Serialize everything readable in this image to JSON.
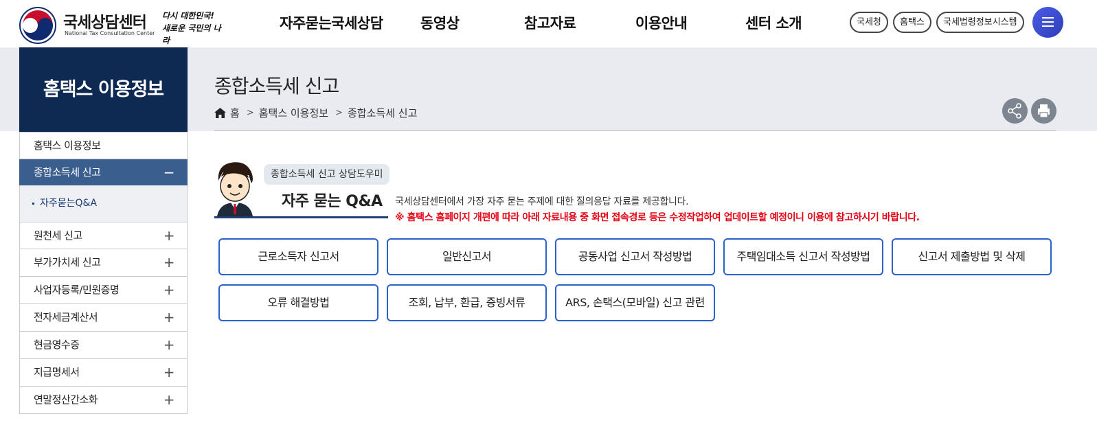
{
  "header": {
    "logo_title": "국세상담센터",
    "logo_subtitle": "National Tax Consultation Center",
    "logo_slogan_line1": "다시 대한민국!",
    "logo_slogan_line2": "새로운 국민의 나라",
    "gnb": [
      "자주묻는국세상담",
      "동영상",
      "참고자료",
      "이용안내",
      "센터 소개"
    ],
    "util_links": [
      "국세청",
      "홈택스",
      "국세법령정보시스템"
    ],
    "menu_icon": "hamburger-icon"
  },
  "sidebar": {
    "title": "홈택스 이용정보",
    "items": [
      {
        "label": "홈택스 이용정보",
        "toggle": ""
      },
      {
        "label": "종합소득세 신고",
        "toggle": "−",
        "active": true
      },
      {
        "label": "원천세 신고",
        "toggle": "+"
      },
      {
        "label": "부가가치세 신고",
        "toggle": "+"
      },
      {
        "label": "사업자등록/민원증명",
        "toggle": "+"
      },
      {
        "label": "전자세금계산서",
        "toggle": "+"
      },
      {
        "label": "현금영수증",
        "toggle": "+"
      },
      {
        "label": "지급명세서",
        "toggle": "+"
      },
      {
        "label": "연말정산간소화",
        "toggle": "+"
      }
    ],
    "sub_item": "자주묻는Q&A"
  },
  "main": {
    "page_title": "종합소득세 신고",
    "breadcrumb": [
      "홈",
      "홈택스 이용정보",
      "종합소득세 신고"
    ],
    "share_icon": "share-icon",
    "print_icon": "print-icon",
    "faq_pill": "종합소득세 신고 상담도우미",
    "faq_title": "자주 묻는 Q&A",
    "faq_desc": "국세상담센터에서 가장 자주 묻는 주제에 대한 질의응답 자료를 제공합니다.",
    "faq_notice": "※ 홈택스 홈페이지 개편에 따라 아래 자료내용 중 화면 접속경로 등은 수정작업하여 업데이트할 예정이니 이용에 참고하시기 바랍니다.",
    "topics": [
      "근로소득자 신고서",
      "일반신고서",
      "공동사업 신고서 작성방법",
      "주택임대소득 신고서 작성방법",
      "신고서 제출방법 및 삭제",
      "오류 해결방법",
      "조회, 납부, 환급, 증빙서류",
      "ARS, 손택스(모바일) 신고 관련"
    ]
  },
  "colors": {
    "navy": "#0f2a52",
    "active_blue": "#3a5f8f",
    "button_border": "#2a62c9",
    "notice_red": "#e60012",
    "band_gray": "#e9ebf0"
  }
}
